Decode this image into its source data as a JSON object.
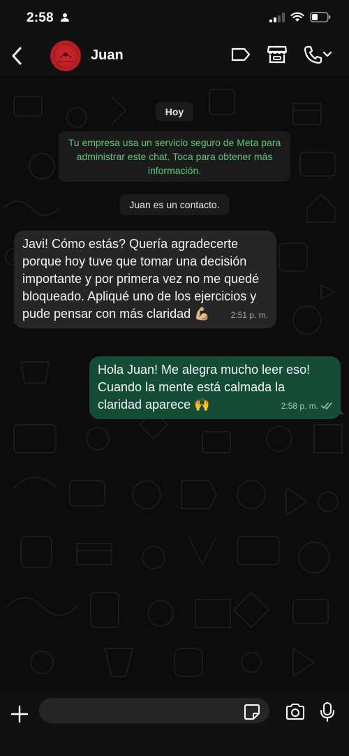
{
  "status_bar": {
    "time": "2:58",
    "icons": [
      "person-icon",
      "signal-icon",
      "wifi-icon",
      "battery-icon"
    ]
  },
  "header": {
    "contact_name": "Juan",
    "icons": [
      "back-chevron-icon",
      "label-tag-icon",
      "store-icon",
      "phone-icon"
    ]
  },
  "chat": {
    "date_label": "Hoy",
    "meta_notice": "Tu empresa usa un servicio seguro de Meta para administrar este chat. Toca para obtener más información.",
    "contact_notice": "Juan es un contacto.",
    "messages": [
      {
        "direction": "in",
        "text": "Javi! Cómo estás? Quería agradecerte porque hoy tuve que tomar una decisión importante y por primera vez no me quedé bloqueado. Apliqué uno de los ejercicios y pude pensar con más claridad 💪🏼",
        "time": "2:51 p. m."
      },
      {
        "direction": "out",
        "text": "Hola Juan! Me alegra mucho leer eso! Cuando la mente está calmada la claridad aparece 🙌",
        "time": "2:58 p. m.",
        "status": "read"
      }
    ]
  },
  "input_bar": {
    "value": "",
    "icons": [
      "plus-icon",
      "sticker-icon",
      "camera-icon",
      "microphone-icon"
    ]
  },
  "colors": {
    "accent_green": "#59c97b",
    "outgoing_bubble": "#144d37",
    "incoming_bubble": "#262626"
  }
}
